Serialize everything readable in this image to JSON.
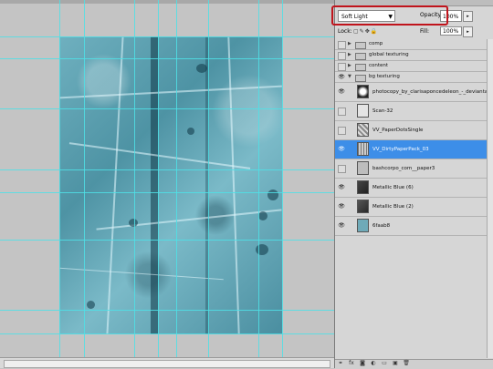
{
  "layers_panel": {
    "blend_mode": "Soft Light",
    "opacity_label": "Opacity:",
    "opacity_value": "100%",
    "lock_label": "Lock:",
    "fill_label": "Fill:",
    "fill_value": "100%",
    "highlight_color": "#c0141c",
    "selected_color": "#3d8ee8",
    "layers": [
      {
        "name": "comp",
        "kind": "group",
        "visible": false
      },
      {
        "name": "global texturing",
        "kind": "group",
        "visible": false
      },
      {
        "name": "content",
        "kind": "group",
        "visible": false
      },
      {
        "name": "bg texturing",
        "kind": "group",
        "visible": true,
        "expanded": true
      },
      {
        "name": "photocopy_by_clarisaponcedeleon_-_deviantart",
        "kind": "layer",
        "visible": true
      },
      {
        "name": "Scan-32",
        "kind": "layer",
        "visible": false
      },
      {
        "name": "VV_PaperDotsSingle",
        "kind": "layer",
        "visible": false
      },
      {
        "name": "VV_DirtyPaperPack_03",
        "kind": "layer",
        "visible": true,
        "selected": true
      },
      {
        "name": "bashcorpo_com__paper3",
        "kind": "layer",
        "visible": false
      },
      {
        "name": "Metallic Blue (6)",
        "kind": "layer",
        "visible": true
      },
      {
        "name": "Metallic Blue (2)",
        "kind": "layer",
        "visible": true
      },
      {
        "name": "6faab8",
        "kind": "fill",
        "visible": true,
        "color": "#6faab8"
      }
    ]
  },
  "canvas": {
    "guide_color": "#4fe0e6",
    "texture_color": "#5a9fb0"
  },
  "icons": {
    "eye": "eye-icon",
    "folder": "folder-icon",
    "expand": "triangle-icon",
    "link": "link-icon",
    "fx": "fx-icon",
    "mask": "mask-icon",
    "adjustment": "adjustment-icon",
    "new_group": "new-group-icon",
    "new_layer": "new-layer-icon",
    "trash": "trash-icon"
  }
}
